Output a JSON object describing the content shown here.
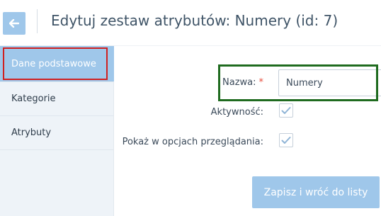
{
  "header": {
    "back_icon": "arrow-left-icon",
    "title": "Edytuj zestaw atrybutów: Numery (id: 7)"
  },
  "sidebar": {
    "items": [
      {
        "label": "Dane podstawowe",
        "active": true
      },
      {
        "label": "Kategorie",
        "active": false
      },
      {
        "label": "Atrybuty",
        "active": false
      }
    ]
  },
  "form": {
    "name_label": "Nazwa:",
    "required_marker": "*",
    "name_value": "Numery",
    "active_label": "Aktywność:",
    "active_checked": true,
    "show_label": "Pokaż w opcjach przeglądania:",
    "show_checked": true
  },
  "actions": {
    "save_label": "Zapisz i wróć do listy"
  },
  "colors": {
    "accent": "#9fc7ea",
    "sidebar_bg": "#eef3f8",
    "required": "#e74c3c",
    "highlight_red": "#d02020",
    "highlight_green": "#1f6b1f"
  }
}
